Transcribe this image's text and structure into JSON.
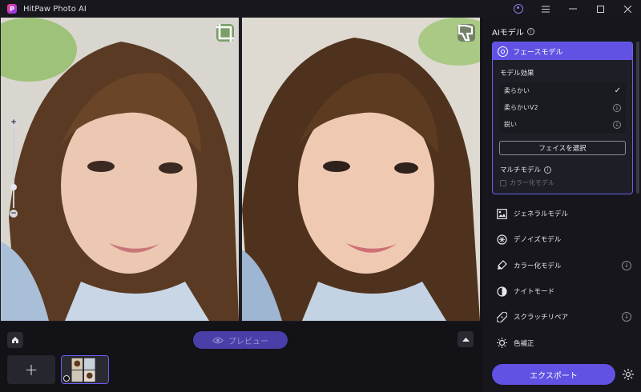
{
  "app": {
    "title": "HitPaw Photo AI",
    "logo_letter": "P"
  },
  "titlebar": {
    "account_icon": "user-icon",
    "menu_icon": "menu-icon",
    "minimize_icon": "minimize-icon",
    "maximize_icon": "maximize-icon",
    "close_icon": "close-icon"
  },
  "canvas": {
    "left_overlay_icon": "crop-icon",
    "right_overlay_icon": "dislike-icon",
    "zoom": {
      "plus": "+",
      "minus": "−",
      "level": 0.2
    }
  },
  "bottom": {
    "home_icon": "home-icon",
    "preview_label": "プレビュー",
    "collapse_icon": "chevron-up-icon",
    "add_label": "+"
  },
  "sidebar": {
    "title": "AIモデル",
    "face_model": {
      "label": "フェースモデル",
      "effect_title": "モデル効果",
      "options": [
        {
          "label": "柔らかい",
          "selected": true
        },
        {
          "label": "柔らかいV2",
          "selected": false
        },
        {
          "label": "鋭い",
          "selected": false
        }
      ],
      "select_face_label": "フェイスを選択",
      "multi_title": "マルチモデル",
      "multi_option": "カラー化モデル"
    },
    "models": [
      {
        "label": "ジェネラルモデル",
        "icon": "image-icon",
        "download": false
      },
      {
        "label": "デノイズモデル",
        "icon": "denoise-icon",
        "download": false
      },
      {
        "label": "カラー化モデル",
        "icon": "brush-icon",
        "download": true
      },
      {
        "label": "ナイトモード",
        "icon": "half-circle-icon",
        "download": false
      },
      {
        "label": "スクラッチリペア",
        "icon": "bandage-icon",
        "download": true
      },
      {
        "label": "色補正",
        "icon": "sun-icon",
        "download": false
      }
    ],
    "export_label": "エクスポート"
  },
  "colors": {
    "accent": "#6152e4",
    "background": "#121217"
  }
}
